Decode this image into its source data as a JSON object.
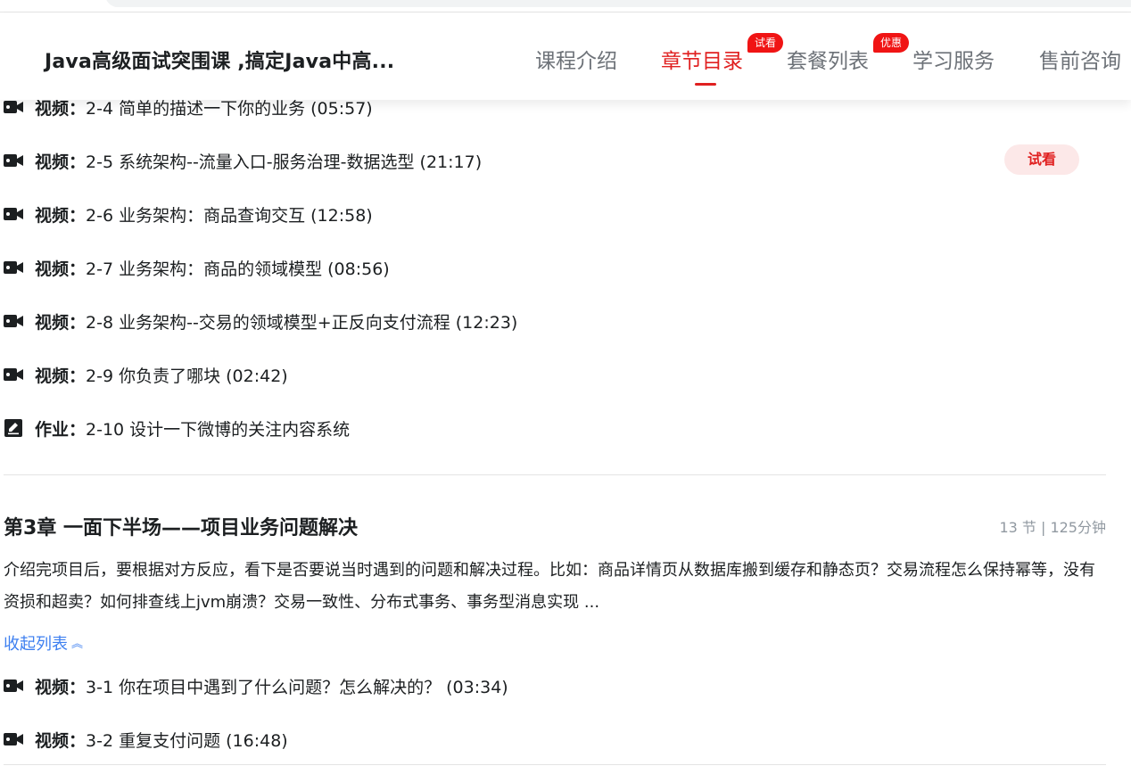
{
  "header": {
    "course_title": "Java高级面试突围课 ,搞定Java中高...",
    "tabs": [
      {
        "label": "课程介绍"
      },
      {
        "label": "章节目录",
        "badge": "试看"
      },
      {
        "label": "套餐列表",
        "badge": "优惠"
      },
      {
        "label": "学习服务"
      },
      {
        "label": "售前咨询"
      }
    ]
  },
  "chapter2_items": [
    {
      "type": "视频：",
      "text": "2-4 简单的描述一下你的业务 (05:57)",
      "icon": "video-icon"
    },
    {
      "type": "视频：",
      "text": "2-5 系统架构--流量入口-服务治理-数据选型 (21:17)",
      "icon": "video-icon",
      "free": "试看"
    },
    {
      "type": "视频：",
      "text": "2-6 业务架构：商品查询交互 (12:58)",
      "icon": "video-icon"
    },
    {
      "type": "视频：",
      "text": "2-7 业务架构：商品的领域模型 (08:56)",
      "icon": "video-icon"
    },
    {
      "type": "视频：",
      "text": "2-8 业务架构--交易的领域模型+正反向支付流程 (12:23)",
      "icon": "video-icon"
    },
    {
      "type": "视频：",
      "text": "2-9 你负责了哪块 (02:42)",
      "icon": "video-icon"
    },
    {
      "type": "作业：",
      "text": "2-10 设计一下微博的关注内容系统",
      "icon": "homework-icon"
    }
  ],
  "chapter3": {
    "title": "第3章 一面下半场——项目业务问题解决",
    "meta": "13 节 | 125分钟",
    "desc": "介绍完项目后，要根据对方反应，看下是否要说当时遇到的问题和解决过程。比如：商品详情页从数据库搬到缓存和静态页？交易流程怎么保持幂等，没有资损和超卖？如何排查线上jvm崩溃？交易一致性、分布式事务、事务型消息实现 ...",
    "collapse_label": "收起列表",
    "items": [
      {
        "type": "视频：",
        "text": "3-1 你在项目中遇到了什么问题？怎么解决的？ (03:34)",
        "icon": "video-icon"
      },
      {
        "type": "视频：",
        "text": "3-2 重复支付问题 (16:48)",
        "icon": "video-icon"
      }
    ]
  },
  "colors": {
    "accent": "#e02020",
    "link": "#3d7ff0",
    "text": "#1c1f21",
    "muted": "#9199a1"
  }
}
